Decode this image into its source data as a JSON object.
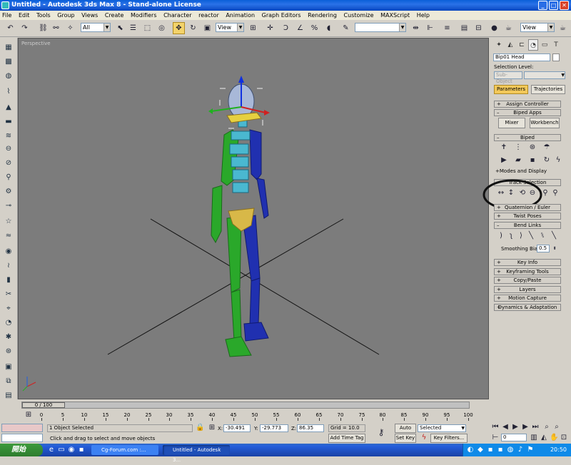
{
  "window": {
    "title": "Untitled - Autodesk 3ds Max 8 - Stand-alone License"
  },
  "menu": [
    "File",
    "Edit",
    "Tools",
    "Group",
    "Views",
    "Create",
    "Modifiers",
    "Character",
    "reactor",
    "Animation",
    "Graph Editors",
    "Rendering",
    "Customize",
    "MAXScript",
    "Help"
  ],
  "toolbar": {
    "selection_filter": "All",
    "ref_coord": "View",
    "named_selection": "",
    "render_type": "View"
  },
  "viewport": {
    "label": "Perspective"
  },
  "command_panel": {
    "object_name": "Bip01 Head",
    "selection_level_label": "Selection Level:",
    "sub_object": "Sub-Object",
    "tab_parameters": "Parameters",
    "tab_trajectories": "Trajectories",
    "rollouts": {
      "assign_controller": "Assign Controller",
      "biped_apps": "Biped Apps",
      "mixer": "Mixer",
      "workbench": "Workbench",
      "biped": "Biped",
      "modes_display": "+Modes and Display",
      "track_selection": "Track Selection",
      "quaternion_euler": "Quaternion / Euler",
      "twist_poses": "Twist Poses",
      "bend_links": "Bend Links",
      "smoothing_bias_label": "Smoothing Bias:",
      "smoothing_bias_value": "0.5",
      "key_info": "Key Info",
      "keyframing_tools": "Keyframing Tools",
      "copy_paste": "Copy/Paste",
      "layers": "Layers",
      "motion_capture": "Motion Capture",
      "dynamics": "Dynamics & Adaptation"
    }
  },
  "timeline": {
    "frame_readout": "0 / 100",
    "ticks": [
      "0",
      "5",
      "10",
      "15",
      "20",
      "25",
      "30",
      "35",
      "40",
      "45",
      "50",
      "55",
      "60",
      "65",
      "70",
      "75",
      "80",
      "85",
      "90",
      "95",
      "100"
    ]
  },
  "status": {
    "selected": "1 Object Selected",
    "prompt": "Click and drag to select and move objects",
    "x_label": "X:",
    "x_value": "-30.491",
    "y_label": "Y:",
    "y_value": "-29.773",
    "z_label": "Z:",
    "z_value": "86.35",
    "grid": "Grid = 10.0",
    "add_time_tag": "Add Time Tag",
    "auto_key": "Auto Key",
    "set_key": "Set Key",
    "key_mode": "Selected",
    "key_filters": "Key Filters...",
    "frame": "0"
  },
  "taskbar": {
    "start": "開始",
    "tasks": [
      "Cg-Forum.com :...",
      "Untitled - Autodesk 3..."
    ],
    "clock": "20:50"
  }
}
